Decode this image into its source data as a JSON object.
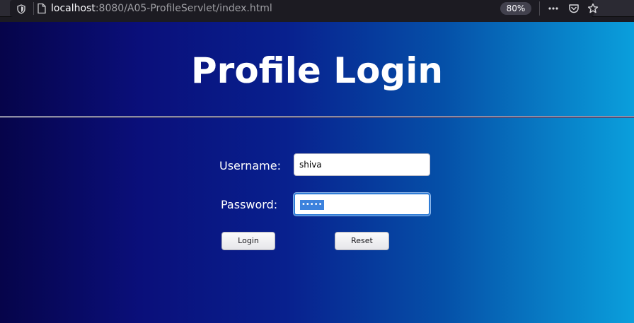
{
  "browser": {
    "url_host": "localhost",
    "url_rest": ":8080/A05-ProfileServlet/index.html",
    "zoom": "80%",
    "icons": [
      "shield-icon",
      "page-icon",
      "more-icon",
      "pocket-icon",
      "star-icon"
    ]
  },
  "page": {
    "title": "Profile Login",
    "background_colors": [
      "#06044a",
      "#0a0f7a",
      "#08208e",
      "#0550a8",
      "#0a9fdc"
    ]
  },
  "form": {
    "username_label": "Username:",
    "username_value": "shiva",
    "password_label": "Password:",
    "password_mask": "•••••",
    "login_label": "Login",
    "reset_label": "Reset"
  }
}
